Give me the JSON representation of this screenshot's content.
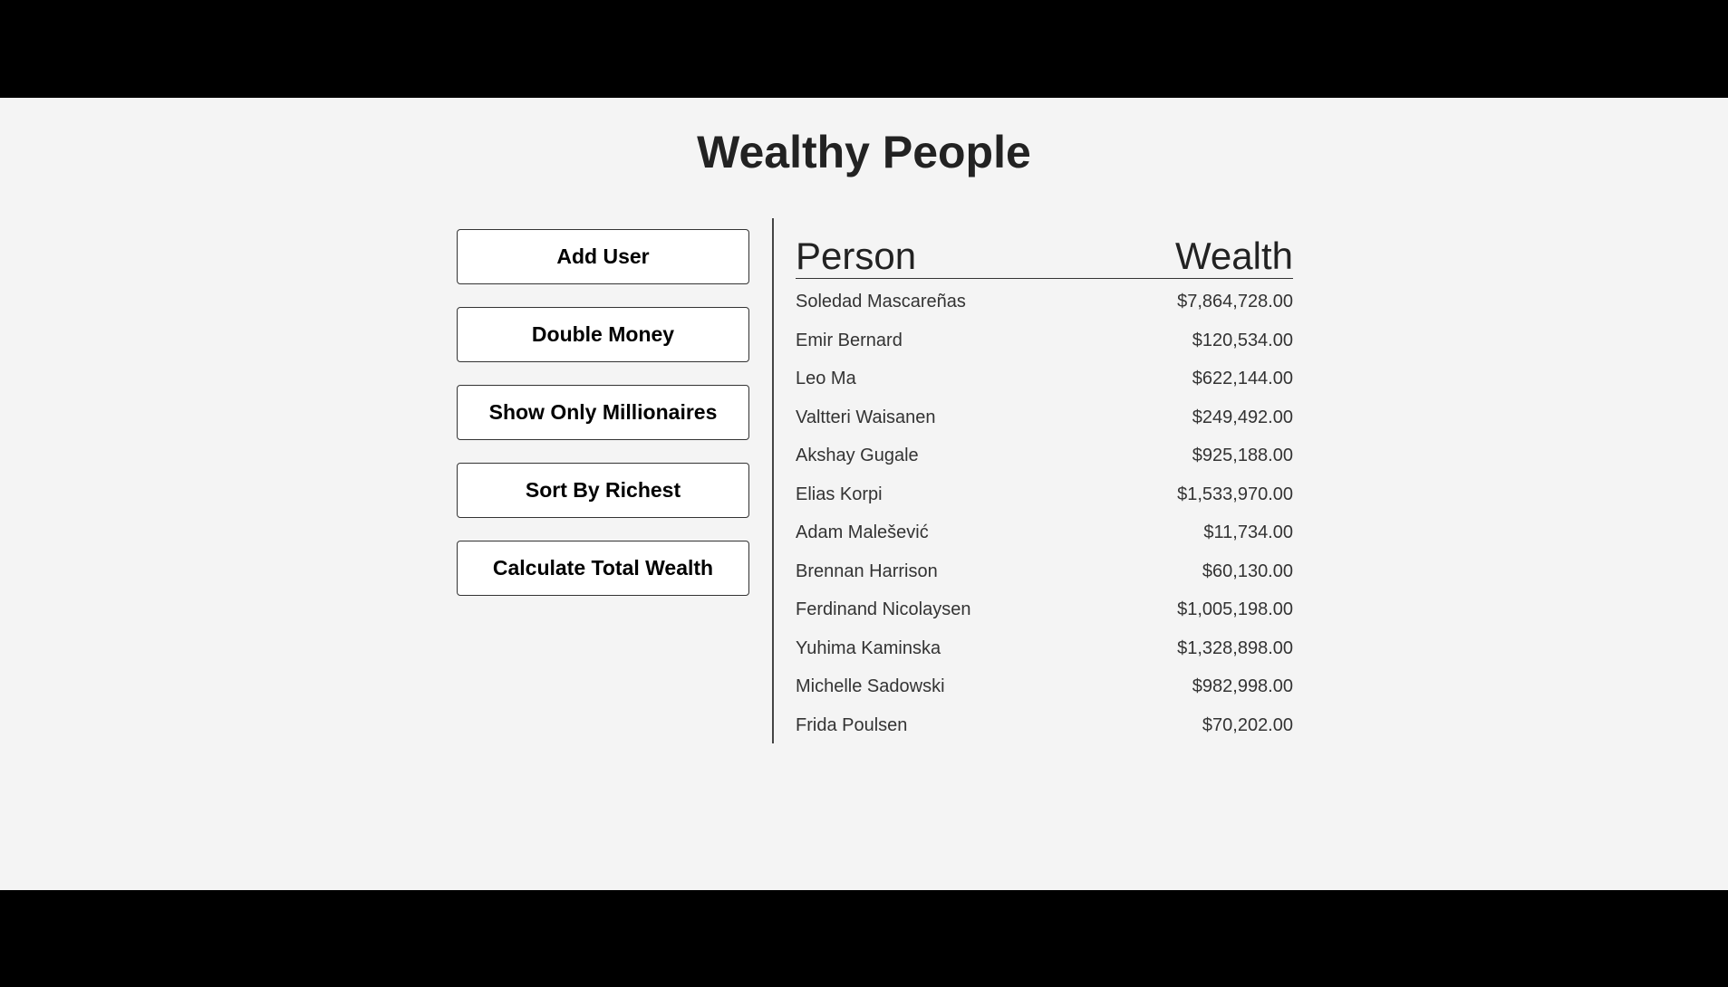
{
  "title": "Wealthy People",
  "buttons": {
    "add_user": "Add User",
    "double_money": "Double Money",
    "show_millionaires": "Show Only Millionaires",
    "sort_richest": "Sort By Richest",
    "calculate_total": "Calculate Total Wealth"
  },
  "table": {
    "header_person": "Person",
    "header_wealth": "Wealth",
    "rows": [
      {
        "name": "Soledad Mascareñas",
        "wealth": "$7,864,728.00"
      },
      {
        "name": "Emir Bernard",
        "wealth": "$120,534.00"
      },
      {
        "name": "Leo Ma",
        "wealth": "$622,144.00"
      },
      {
        "name": "Valtteri Waisanen",
        "wealth": "$249,492.00"
      },
      {
        "name": "Akshay Gugale",
        "wealth": "$925,188.00"
      },
      {
        "name": "Elias Korpi",
        "wealth": "$1,533,970.00"
      },
      {
        "name": "Adam Malešević",
        "wealth": "$11,734.00"
      },
      {
        "name": "Brennan Harrison",
        "wealth": "$60,130.00"
      },
      {
        "name": "Ferdinand Nicolaysen",
        "wealth": "$1,005,198.00"
      },
      {
        "name": "Yuhima Kaminska",
        "wealth": "$1,328,898.00"
      },
      {
        "name": "Michelle Sadowski",
        "wealth": "$982,998.00"
      },
      {
        "name": "Frida Poulsen",
        "wealth": "$70,202.00"
      }
    ]
  }
}
